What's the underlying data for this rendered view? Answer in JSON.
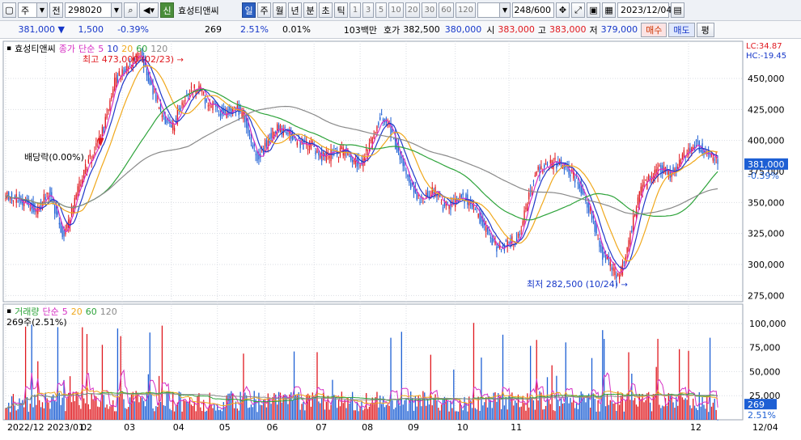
{
  "toolbar": {
    "market": "주",
    "jeon": "전",
    "code": "298020",
    "name": "효성티앤씨",
    "sin": "신",
    "periods": [
      "일",
      "주",
      "월",
      "년",
      "분",
      "초",
      "틱"
    ],
    "active_period": "일",
    "intervals": [
      "1",
      "3",
      "5",
      "10",
      "20",
      "30",
      "60",
      "120"
    ],
    "count": "248/600",
    "date": "2023/12/04"
  },
  "quote": {
    "price": "381,000",
    "change_arrow": "▼",
    "change": "1,500",
    "change_pct": "-0.39%",
    "volume": "269",
    "turnover_pct": "2.51%",
    "ratio": "0.01%",
    "amount": "103백만",
    "ask_label": "호가",
    "ask": "382,500",
    "bid": "380,000",
    "open_label": "시",
    "open": "383,000",
    "high_label": "고",
    "high": "383,000",
    "low_label": "저",
    "low": "379,000",
    "buy_label": "매수",
    "sell_label": "매도",
    "pyeong_label": "평"
  },
  "price_panel": {
    "name": "효성티앤씨",
    "legend_close": "종가",
    "legend_simple": "단순",
    "ma_periods": [
      "5",
      "10",
      "20",
      "60",
      "120"
    ],
    "ma_colors": [
      "#d62fc4",
      "#1f37c9",
      "#f0a81c",
      "#2da33a",
      "#8a8a8a"
    ],
    "lc": "LC:34.87",
    "hc": "HC:-19.45",
    "max_annotation": "최고 473,000 (02/23)",
    "min_annotation": "최저 282,500 (10/24)",
    "dividend_annotation": "배당락(0.00%)",
    "current_price_label": "381,000",
    "current_change_label": "-0.39%",
    "y_ticks": [
      "450,000",
      "425,000",
      "400,000",
      "375,000",
      "350,000",
      "325,000",
      "300,000",
      "275,000"
    ]
  },
  "volume_panel": {
    "name": "거래량",
    "legend_simple": "단순",
    "ma_periods": [
      "5",
      "20",
      "60",
      "120"
    ],
    "ma_colors": [
      "#d62fc4",
      "#f0a81c",
      "#2da33a",
      "#8a8a8a"
    ],
    "info": "269주(2.51%)",
    "y_ticks": [
      "100,000",
      "75,000",
      "50,000",
      "25,000"
    ],
    "current_volume_label": "269",
    "current_pct_label": "2.51%"
  },
  "x_axis": {
    "labels": [
      "2022/12",
      "2023/01",
      "02",
      "03",
      "04",
      "05",
      "06",
      "07",
      "08",
      "09",
      "10",
      "11",
      "12"
    ],
    "right_label": "12/04"
  },
  "chart_data": {
    "type": "candlestick",
    "price_range": [
      270000,
      480000
    ],
    "volume_range": [
      0,
      120000
    ],
    "max": {
      "value": 473000,
      "date": "02/23"
    },
    "min": {
      "value": 282500,
      "date": "10/24"
    },
    "last_close": 381000,
    "anchors": [
      [
        0,
        355000
      ],
      [
        10,
        352000
      ],
      [
        20,
        345000
      ],
      [
        28,
        358000
      ],
      [
        33,
        340000
      ],
      [
        38,
        322000
      ],
      [
        45,
        352000
      ],
      [
        52,
        378000
      ],
      [
        58,
        392000
      ],
      [
        64,
        410000
      ],
      [
        70,
        445000
      ],
      [
        76,
        455000
      ],
      [
        82,
        462000
      ],
      [
        88,
        470000
      ],
      [
        92,
        455000
      ],
      [
        96,
        440000
      ],
      [
        102,
        420000
      ],
      [
        108,
        408000
      ],
      [
        114,
        428000
      ],
      [
        120,
        440000
      ],
      [
        126,
        442000
      ],
      [
        132,
        430000
      ],
      [
        138,
        424000
      ],
      [
        144,
        422000
      ],
      [
        150,
        428000
      ],
      [
        156,
        418000
      ],
      [
        160,
        400000
      ],
      [
        164,
        385000
      ],
      [
        170,
        398000
      ],
      [
        176,
        410000
      ],
      [
        184,
        406000
      ],
      [
        192,
        396000
      ],
      [
        200,
        395000
      ],
      [
        208,
        385000
      ],
      [
        214,
        390000
      ],
      [
        220,
        392000
      ],
      [
        226,
        384000
      ],
      [
        232,
        382000
      ],
      [
        238,
        398000
      ],
      [
        244,
        420000
      ],
      [
        250,
        410000
      ],
      [
        256,
        390000
      ],
      [
        262,
        372000
      ],
      [
        268,
        352000
      ],
      [
        274,
        355000
      ],
      [
        280,
        360000
      ],
      [
        286,
        345000
      ],
      [
        292,
        350000
      ],
      [
        298,
        355000
      ],
      [
        304,
        348000
      ],
      [
        310,
        335000
      ],
      [
        316,
        318000
      ],
      [
        322,
        312000
      ],
      [
        328,
        318000
      ],
      [
        334,
        322000
      ],
      [
        340,
        352000
      ],
      [
        346,
        375000
      ],
      [
        352,
        378000
      ],
      [
        358,
        382000
      ],
      [
        364,
        380000
      ],
      [
        370,
        372000
      ],
      [
        376,
        358000
      ],
      [
        382,
        340000
      ],
      [
        388,
        310000
      ],
      [
        394,
        300000
      ],
      [
        398,
        290000
      ],
      [
        402,
        298000
      ],
      [
        408,
        330000
      ],
      [
        414,
        360000
      ],
      [
        420,
        370000
      ],
      [
        426,
        378000
      ],
      [
        432,
        372000
      ],
      [
        438,
        380000
      ],
      [
        444,
        392000
      ],
      [
        450,
        397000
      ],
      [
        456,
        390000
      ],
      [
        462,
        386000
      ],
      [
        464,
        381000
      ]
    ]
  }
}
